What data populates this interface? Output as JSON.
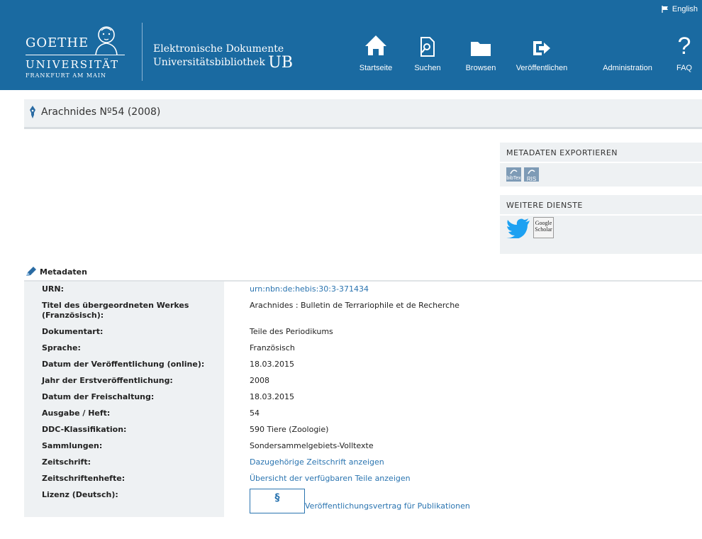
{
  "header": {
    "language_label": "English",
    "brand": {
      "name": "GOETHE",
      "university": "UNIVERSITÄT",
      "city": "FRANKFURT AM MAIN",
      "subtitle_line1": "Elektronische Dokumente",
      "subtitle_line2": "Universitätsbibliothek",
      "subtitle_ub": "UB"
    },
    "nav": [
      {
        "label": "Startseite",
        "icon": "home-icon"
      },
      {
        "label": "Suchen",
        "icon": "search-icon"
      },
      {
        "label": "Browsen",
        "icon": "folder-icon"
      },
      {
        "label": "Veröffentlichen",
        "icon": "publish-icon"
      },
      {
        "label": "Administration",
        "icon": "admin-icon"
      },
      {
        "label": "FAQ",
        "icon": "question-icon"
      }
    ]
  },
  "page_title": "Arachnides Nº54 (2008)",
  "sidebar": {
    "export_title": "METADATEN EXPORTIEREN",
    "export_buttons": [
      "bibTex",
      "RIS"
    ],
    "services_title": "WEITERE DIENSTE",
    "services": [
      "Twitter",
      "Google Scholar"
    ]
  },
  "metadata": {
    "title": "Metadaten",
    "rows": [
      {
        "label": "URN:",
        "value": "urn:nbn:de:hebis:30:3-371434",
        "link": true
      },
      {
        "label": "Titel des übergeordneten Werkes (Französisch):",
        "value": "Arachnides : Bulletin de Terrariophile et de Recherche",
        "link": false
      },
      {
        "label": "Dokumentart:",
        "value": "Teile des Periodikums",
        "link": false
      },
      {
        "label": "Sprache:",
        "value": "Französisch",
        "link": false
      },
      {
        "label": "Datum der Veröffentlichung (online):",
        "value": "18.03.2015",
        "link": false
      },
      {
        "label": "Jahr der Erstveröffentlichung:",
        "value": "2008",
        "link": false
      },
      {
        "label": "Datum der Freischaltung:",
        "value": "18.03.2015",
        "link": false
      },
      {
        "label": "Ausgabe / Heft:",
        "value": "54",
        "link": false
      },
      {
        "label": "DDC-Klassifikation:",
        "value": "590 Tiere (Zoologie)",
        "link": false
      },
      {
        "label": "Sammlungen:",
        "value": "Sondersammelgebiets-Volltexte",
        "link": false
      },
      {
        "label": "Zeitschrift:",
        "value": "Dazugehörige Zeitschrift anzeigen",
        "link": true
      },
      {
        "label": "Zeitschriftenhefte:",
        "value": "Übersicht der verfügbaren Teile anzeigen",
        "link": true
      }
    ],
    "license_label": "Lizenz (Deutsch):",
    "license_symbol": "§",
    "license_link": "Veröffentlichungsvertrag für Publikationen"
  },
  "colors": {
    "header_bg": "#1a6aa1",
    "link": "#2a74b0",
    "panel_bg": "#eef1f3"
  }
}
